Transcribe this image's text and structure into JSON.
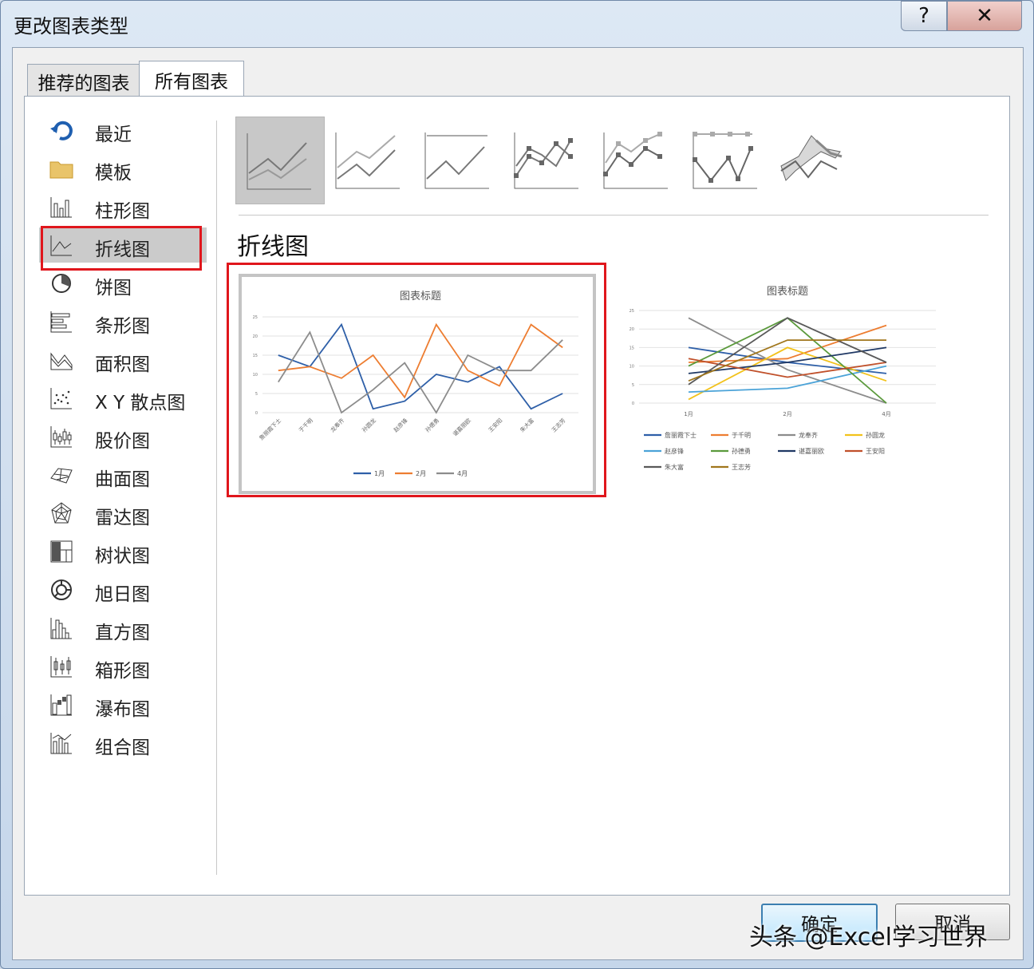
{
  "dialog": {
    "title": "更改图表类型",
    "help_label": "?",
    "close_label": "✕"
  },
  "tabs": [
    {
      "label": "推荐的图表",
      "active": false
    },
    {
      "label": "所有图表",
      "active": true
    }
  ],
  "chart_types": [
    {
      "label": "最近",
      "icon": "recent-icon"
    },
    {
      "label": "模板",
      "icon": "folder-icon"
    },
    {
      "label": "柱形图",
      "icon": "column-chart-icon"
    },
    {
      "label": "折线图",
      "icon": "line-chart-icon",
      "selected": true
    },
    {
      "label": "饼图",
      "icon": "pie-chart-icon"
    },
    {
      "label": "条形图",
      "icon": "bar-chart-icon"
    },
    {
      "label": "面积图",
      "icon": "area-chart-icon"
    },
    {
      "label": "X Y 散点图",
      "icon": "scatter-chart-icon"
    },
    {
      "label": "股价图",
      "icon": "stock-chart-icon"
    },
    {
      "label": "曲面图",
      "icon": "surface-chart-icon"
    },
    {
      "label": "雷达图",
      "icon": "radar-chart-icon"
    },
    {
      "label": "树状图",
      "icon": "treemap-chart-icon"
    },
    {
      "label": "旭日图",
      "icon": "sunburst-chart-icon"
    },
    {
      "label": "直方图",
      "icon": "histogram-chart-icon"
    },
    {
      "label": "箱形图",
      "icon": "box-whisker-chart-icon"
    },
    {
      "label": "瀑布图",
      "icon": "waterfall-chart-icon"
    },
    {
      "label": "组合图",
      "icon": "combo-chart-icon"
    }
  ],
  "subtypes": [
    {
      "icon": "line-subtype-icon",
      "selected": true
    },
    {
      "icon": "stacked-line-subtype-icon"
    },
    {
      "icon": "percent-stacked-line-subtype-icon"
    },
    {
      "icon": "line-with-markers-subtype-icon"
    },
    {
      "icon": "stacked-line-markers-subtype-icon"
    },
    {
      "icon": "percent-stacked-line-markers-subtype-icon"
    },
    {
      "icon": "3d-line-subtype-icon"
    }
  ],
  "section_title": "折线图",
  "colors": {
    "accent_red": "#e0161c",
    "series_blue": "#2e5fa8",
    "series_orange": "#ed7d31",
    "series_gray": "#7f7f7f"
  },
  "chart_data": [
    {
      "type": "line",
      "title": "图表标题",
      "categories": [
        "詹丽霞下士",
        "于千明",
        "龙奉齐",
        "孙圆龙",
        "赵彦锋",
        "孙德勇",
        "谌嘉丽欧",
        "王安阳",
        "朱大富",
        "王志芳"
      ],
      "ylim": [
        0,
        25
      ],
      "yticks": [
        "25",
        "20",
        "15",
        "10",
        "5",
        "0"
      ],
      "series": [
        {
          "name": "1月",
          "color": "#2e5fa8",
          "values": [
            15,
            12,
            23,
            1,
            3,
            10,
            8,
            12,
            1,
            5
          ]
        },
        {
          "name": "2月",
          "color": "#ed7d31",
          "values": [
            11,
            12,
            9,
            15,
            4,
            23,
            11,
            7,
            23,
            17
          ]
        },
        {
          "name": "4月",
          "color": "#8c8c8c",
          "values": [
            8,
            21,
            0,
            6,
            13,
            0,
            15,
            11,
            11,
            19
          ]
        }
      ]
    },
    {
      "type": "line",
      "title": "图表标题",
      "categories": [
        "1月",
        "2月",
        "4月"
      ],
      "ylim": [
        0,
        25
      ],
      "yticks": [
        "25",
        "20",
        "15",
        "10",
        "5",
        "0"
      ],
      "series": [
        {
          "name": "詹丽霞下士",
          "color": "#2e5fa8",
          "values": [
            15,
            11,
            8
          ]
        },
        {
          "name": "于千明",
          "color": "#ed7d31",
          "values": [
            11,
            12,
            21
          ]
        },
        {
          "name": "龙奉齐",
          "color": "#8c8c8c",
          "values": [
            23,
            9,
            0
          ]
        },
        {
          "name": "孙圆龙",
          "color": "#f2c21b",
          "values": [
            1,
            15,
            6
          ]
        },
        {
          "name": "赵彦锋",
          "color": "#4ba3d8",
          "values": [
            3,
            4,
            10
          ]
        },
        {
          "name": "孙德勇",
          "color": "#5b9a3c",
          "values": [
            10,
            23,
            0
          ]
        },
        {
          "name": "谌嘉丽欧",
          "color": "#1f3864",
          "values": [
            8,
            11,
            15
          ]
        },
        {
          "name": "王安阳",
          "color": "#c0502a",
          "values": [
            12,
            7,
            11
          ]
        },
        {
          "name": "朱大富",
          "color": "#595959",
          "values": [
            5,
            23,
            11
          ]
        },
        {
          "name": "王志芳",
          "color": "#a0761c",
          "values": [
            6,
            17,
            17
          ]
        }
      ]
    }
  ],
  "buttons": {
    "ok": "确定",
    "cancel": "取消"
  },
  "watermark": "头条 @Excel学习世界"
}
